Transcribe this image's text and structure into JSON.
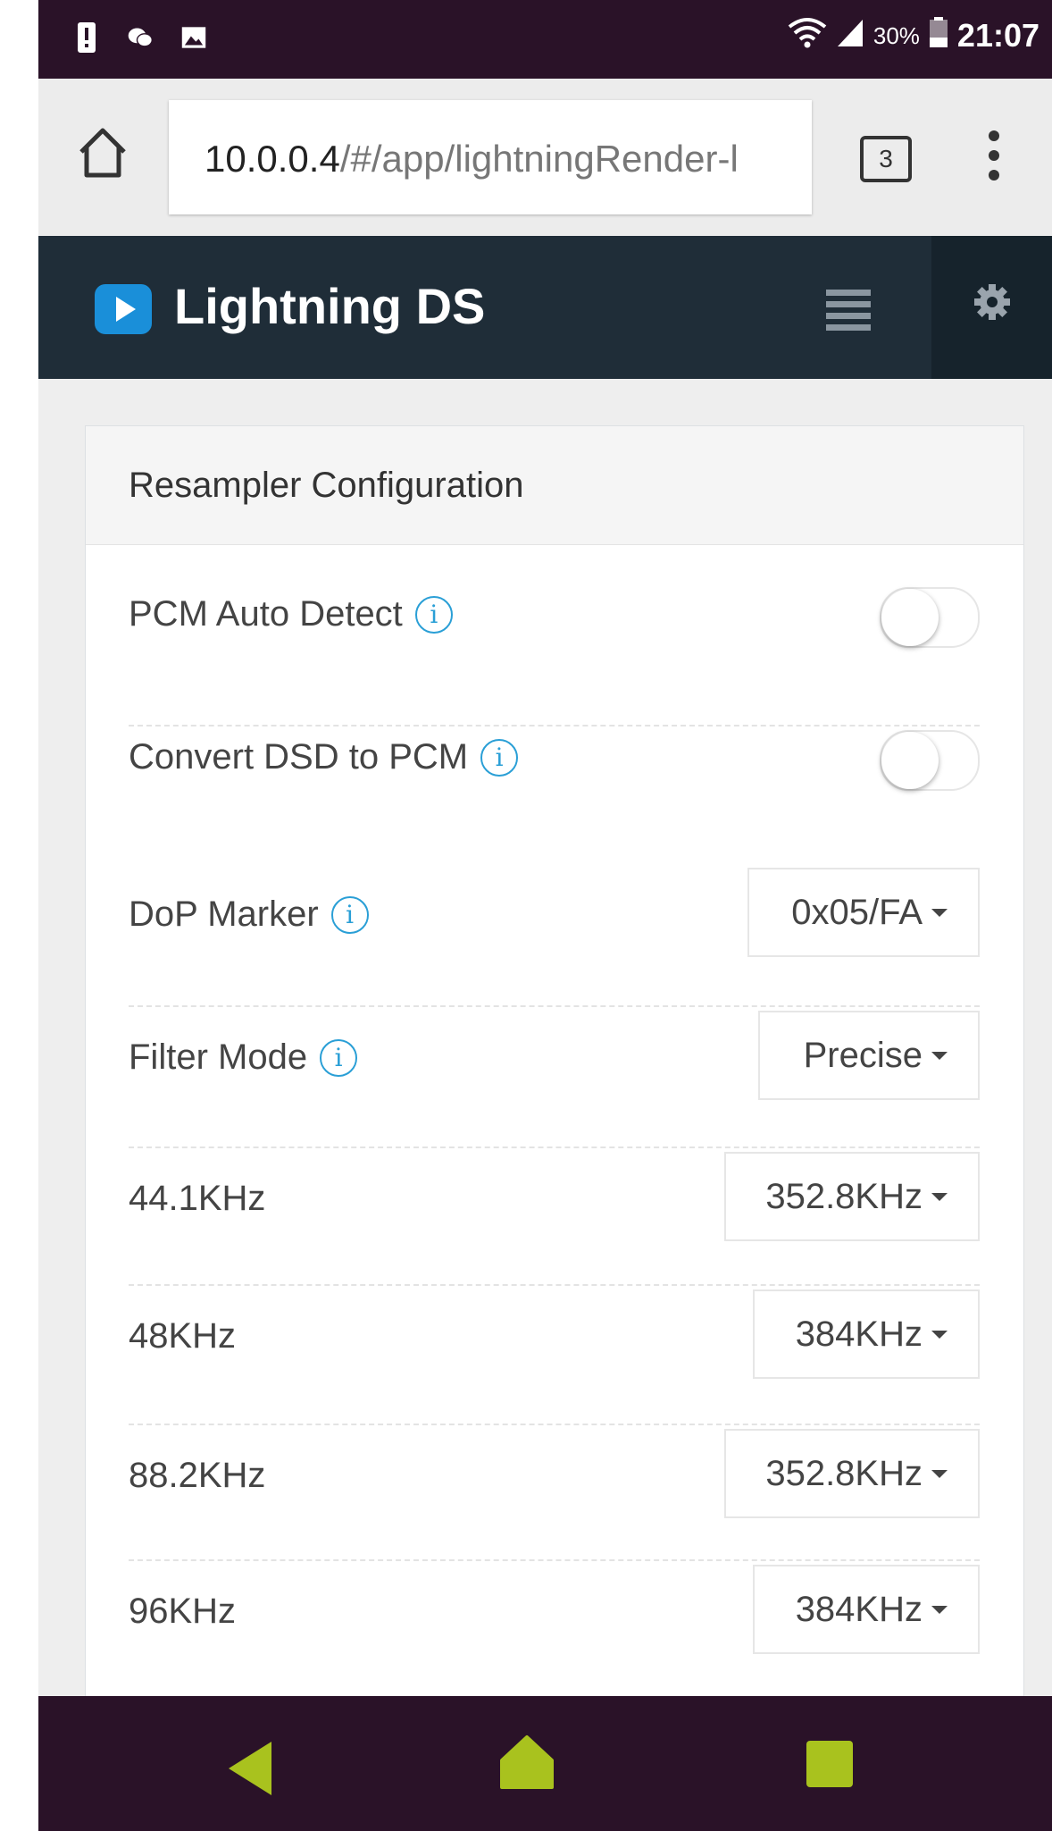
{
  "status_bar": {
    "battery_percent": "30%",
    "time": "21:07"
  },
  "browser": {
    "url_host": "10.0.0.4",
    "url_path": "/#/app/lightningRender-l",
    "tab_count": "3"
  },
  "app": {
    "title": "Lightning DS"
  },
  "card": {
    "title": "Resampler Configuration",
    "toggles": [
      {
        "label": "PCM Auto Detect",
        "on": false
      },
      {
        "label": "Convert DSD to PCM",
        "on": false
      }
    ],
    "selects": [
      {
        "label": "DoP Marker",
        "value": "0x05/FA"
      },
      {
        "label": "Filter Mode",
        "value": "Precise"
      },
      {
        "label": "44.1KHz",
        "value": "352.8KHz"
      },
      {
        "label": "48KHz",
        "value": "384KHz"
      },
      {
        "label": "88.2KHz",
        "value": "352.8KHz"
      },
      {
        "label": "96KHz",
        "value": "384KHz"
      }
    ]
  },
  "colors": {
    "status_bar_bg": "#2a1228",
    "app_header_bg": "#1f2d38",
    "accent_blue": "#2a9fd6",
    "nav_icon": "#a9c21e"
  }
}
